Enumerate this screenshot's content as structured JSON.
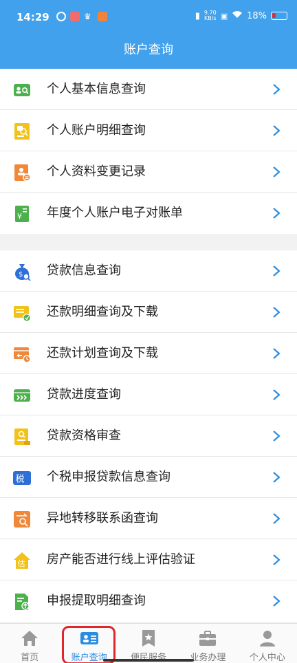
{
  "status_bar": {
    "time": "14:29",
    "net_speed_value": "9.70",
    "net_speed_unit": "KB/s",
    "battery_percent": "18%"
  },
  "header": {
    "title": "账户查询"
  },
  "groups": [
    [
      {
        "label": "个人基本信息查询",
        "icon": "id-card-search-icon"
      },
      {
        "label": "个人账户明细查询",
        "icon": "document-search-icon"
      },
      {
        "label": "个人资料变更记录",
        "icon": "profile-edit-icon"
      },
      {
        "label": "年度个人账户电子对账单",
        "icon": "yuan-statement-icon"
      }
    ],
    [
      {
        "label": "贷款信息查询",
        "icon": "money-bag-search-icon"
      },
      {
        "label": "还款明细查询及下载",
        "icon": "repayment-detail-icon"
      },
      {
        "label": "还款计划查询及下载",
        "icon": "repayment-plan-icon"
      },
      {
        "label": "贷款进度查询",
        "icon": "loan-progress-icon"
      },
      {
        "label": "贷款资格审查",
        "icon": "qualification-icon"
      },
      {
        "label": "个税申报贷款信息查询",
        "icon": "tax-badge-icon"
      },
      {
        "label": "异地转移联系函查询",
        "icon": "transfer-search-icon"
      },
      {
        "label": "房产能否进行线上评估验证",
        "icon": "house-estimate-icon"
      },
      {
        "label": "申报提取明细查询",
        "icon": "withdraw-upload-icon"
      }
    ]
  ],
  "icon_badges": {
    "tax": "税",
    "estimate": "估",
    "yuan": "¥"
  },
  "tabs": [
    {
      "label": "首页",
      "icon": "home-icon"
    },
    {
      "label": "账户查询",
      "icon": "account-card-icon",
      "active": true
    },
    {
      "label": "便民服务",
      "icon": "service-star-icon"
    },
    {
      "label": "业务办理",
      "icon": "briefcase-icon"
    },
    {
      "label": "个人中心",
      "icon": "person-icon"
    }
  ],
  "colors": {
    "primary": "#41a1ec",
    "active_tab": "#2b8de0",
    "highlight_outline": "#e0252c",
    "chevron": "#2b8de0"
  }
}
